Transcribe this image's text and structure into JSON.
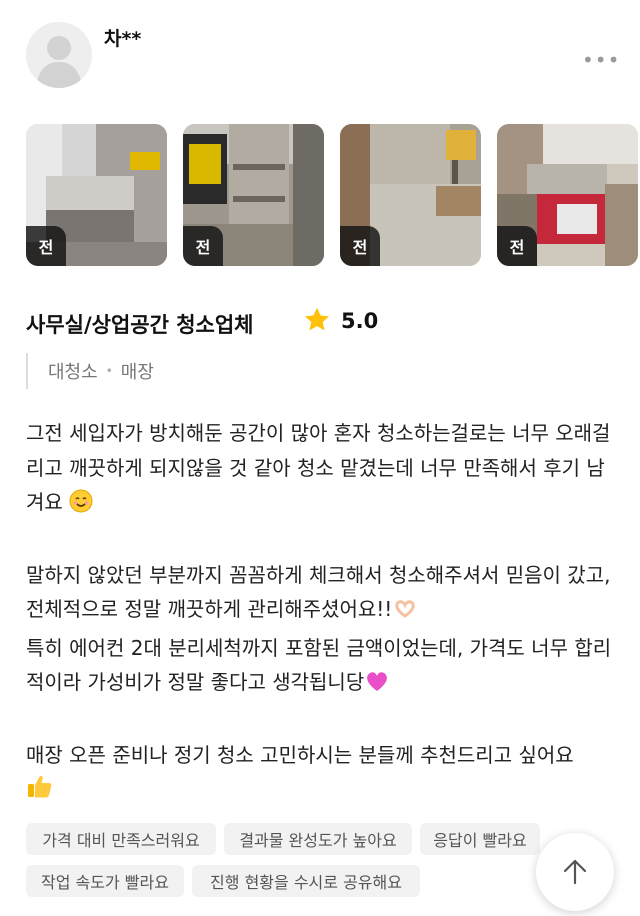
{
  "reviewer": {
    "name": "차**",
    "avatar_icon": "default-user-icon",
    "more_icon": "more-dots-icon"
  },
  "photos": [
    {
      "label": "전",
      "scene": "office-counter"
    },
    {
      "label": "전",
      "scene": "storage-shelf-bag"
    },
    {
      "label": "전",
      "scene": "shelf-corner"
    },
    {
      "label": "전",
      "scene": "cluttered-items"
    }
  ],
  "service": {
    "title": "사무실/상업공간 청소업체",
    "rating": "5.0",
    "star_icon": "star-icon",
    "star_color": "#ffc107"
  },
  "categories": [
    "대청소",
    "매장"
  ],
  "review": {
    "para1": "그전 세입자가 방치해둔 공간이 많아 혼자 청소하는걸로는 너무 오래걸리고 깨끗하게 되지않을 것 같아 청소 맡겼는데 너무 만족해서 후기 남겨요",
    "para1_emoji": "smiling-face-icon",
    "para2": "말하지 않았던 부분까지 꼼꼼하게 체크해서 청소해주셔서 믿음이 갔고, 전체적으로 정말 깨끗하게 관리해주셨어요!!",
    "para2_emoji": "heart-hands-icon",
    "para3": "특히 에어컨 2대 분리세척까지 포함된 금액이었는데, 가격도 너무 합리적이라 가성비가 정말 좋다고 생각됩니당",
    "para3_emoji": "pink-heart-icon",
    "para4": "매장 오픈 준비나 정기 청소 고민하시는 분들께 추천드리고 싶어요",
    "para4_emoji": "thumbs-up-icon"
  },
  "tags": [
    "가격 대비 만족스러워요",
    "결과물 완성도가 높아요",
    "응답이 빨라요",
    "작업 속도가 빨라요",
    "진행 현황을 수시로 공유해요"
  ],
  "scroll_top_icon": "arrow-up-icon"
}
